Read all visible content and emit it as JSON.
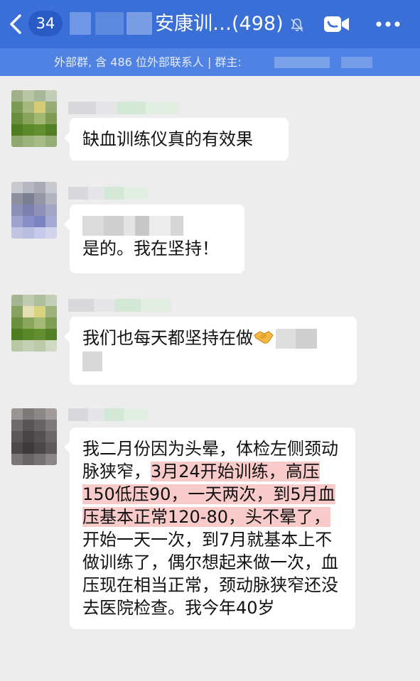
{
  "header": {
    "unread_count": "34",
    "chat_title": "安康训…(498)",
    "group_info": "外部群, 含 486 位外部联系人 | 群主:"
  },
  "messages": [
    {
      "text": "缺血训练仪真的有效果"
    },
    {
      "text": "是的。我在坚持！"
    },
    {
      "text": "我们也每天都坚持在做"
    },
    {
      "segments": [
        "我二月份因为头晕，体检左侧颈动脉狭窄，",
        "3月24开始训练，高压150低压90，一天两次，到5月血压基本正常120-80，头不晕了，",
        "开始一天一次，到7月就基本上不做训练了，偶尔想起来做一次，血压现在相当正常，颈动脉狭窄还没去医院检查。我今年40岁"
      ]
    }
  ],
  "colors": {
    "header_bg": "#3a6fd8",
    "subheader_bg": "#4f82e2",
    "chat_bg": "#ededed",
    "bubble_bg": "#ffffff",
    "highlight": "#f8caca"
  },
  "icons": [
    "back-chevron-icon",
    "mute-bell-icon",
    "video-call-icon",
    "more-dots-icon",
    "handshake-emoji"
  ]
}
